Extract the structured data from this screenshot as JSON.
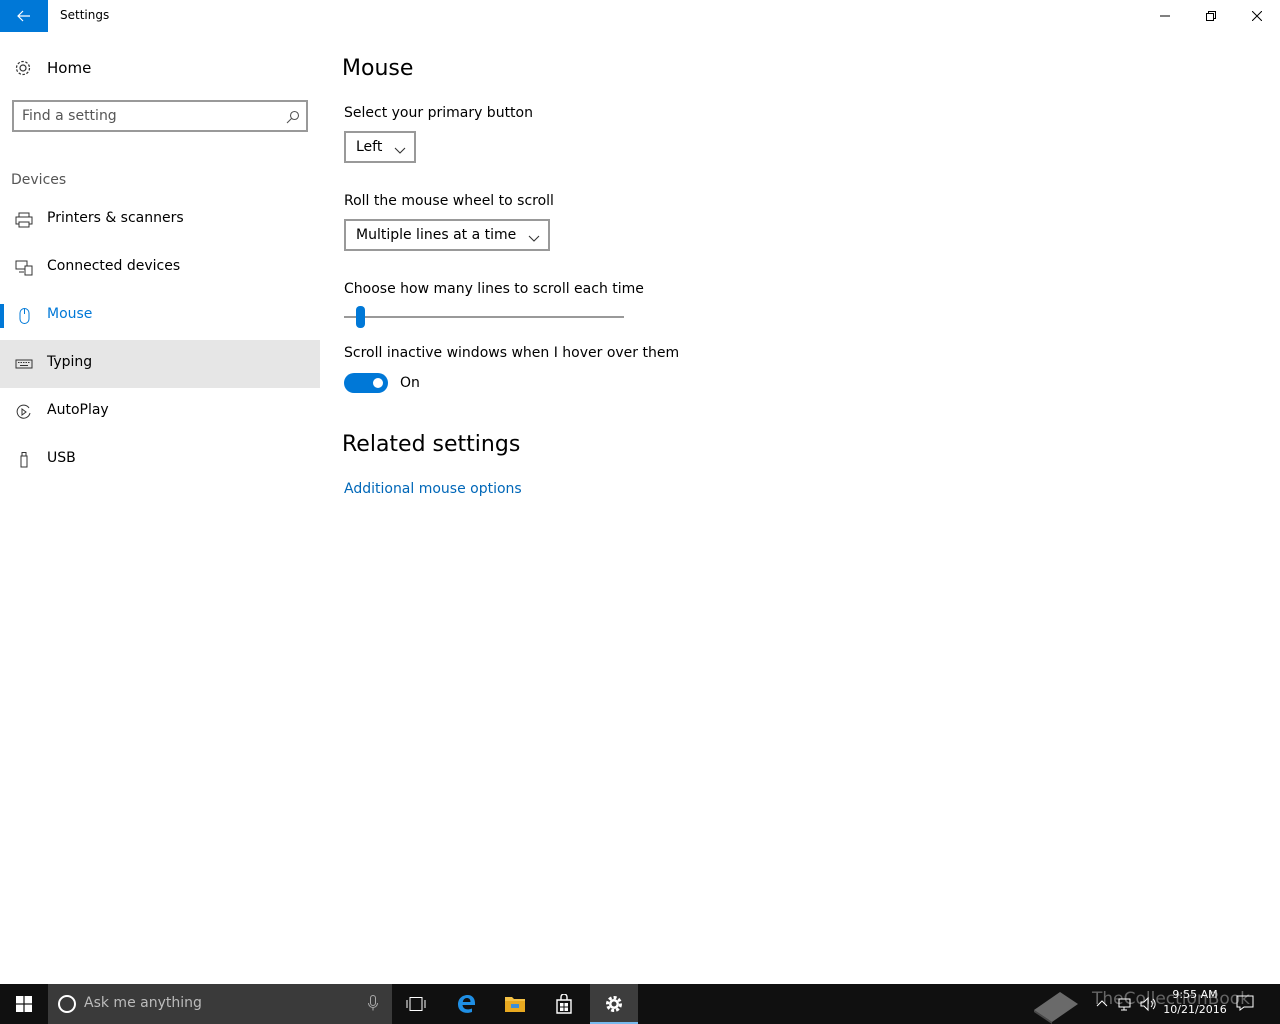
{
  "window": {
    "title": "Settings"
  },
  "sidebar": {
    "home_label": "Home",
    "search_placeholder": "Find a setting",
    "section_label": "Devices",
    "items": [
      {
        "label": "Printers & scanners",
        "icon": "printer-icon"
      },
      {
        "label": "Connected devices",
        "icon": "connected-devices-icon"
      },
      {
        "label": "Mouse",
        "icon": "mouse-icon",
        "active": true
      },
      {
        "label": "Typing",
        "icon": "keyboard-icon",
        "hovered": true
      },
      {
        "label": "AutoPlay",
        "icon": "autoplay-icon"
      },
      {
        "label": "USB",
        "icon": "usb-icon"
      }
    ]
  },
  "main": {
    "title": "Mouse",
    "primary_button_label": "Select your primary button",
    "primary_button_value": "Left",
    "wheel_label": "Roll the mouse wheel to scroll",
    "wheel_value": "Multiple lines at a time",
    "lines_label": "Choose how many lines to scroll each time",
    "lines_slider_position": 0.03,
    "inactive_label": "Scroll inactive windows when I hover over them",
    "inactive_toggle": "On",
    "related_title": "Related settings",
    "related_link": "Additional mouse options"
  },
  "taskbar": {
    "cortana_placeholder": "Ask me anything",
    "time": "9:55 AM",
    "date": "10/21/2016",
    "watermark": "TheCollectionBook"
  },
  "colors": {
    "accent": "#0078d7",
    "link": "#0067b8",
    "taskbar": "#101010"
  }
}
